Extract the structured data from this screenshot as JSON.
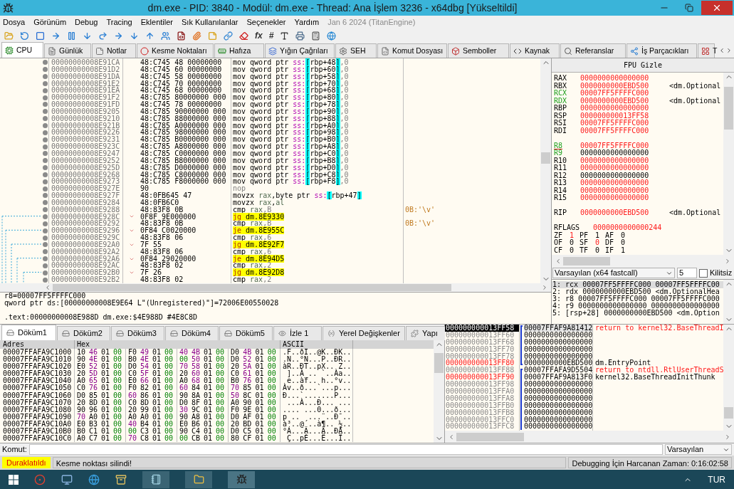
{
  "window": {
    "title": "dm.exe - PID: 3840 - Modül: dm.exe - Thread: Ana İşlem 3236 - x64dbg [Yükseltildi]"
  },
  "menu": {
    "items": [
      "Dosya",
      "Görünüm",
      "Debug",
      "Tracing",
      "Eklentiler",
      "Sık Kullanılanlar",
      "Seçenekler",
      "Yardım"
    ],
    "build_info": "Jan 6 2024 (TitanEngine)"
  },
  "toolbar": {
    "texts": [
      "fx",
      "#"
    ]
  },
  "tabs": [
    {
      "label": "CPU",
      "selected": true
    },
    {
      "label": "Günlük",
      "selected": false
    },
    {
      "label": "Notlar",
      "selected": false
    },
    {
      "label": "Kesme Noktaları",
      "selected": false
    },
    {
      "label": "Hafıza",
      "selected": false
    },
    {
      "label": "Yığın Çağrıları",
      "selected": false
    },
    {
      "label": "SEH",
      "selected": false
    },
    {
      "label": "Komut Dosyası",
      "selected": false
    },
    {
      "label": "Semboller",
      "selected": false
    },
    {
      "label": "Kaynak",
      "selected": false
    },
    {
      "label": "Referanslar",
      "selected": false
    },
    {
      "label": "İş Parçacıkları",
      "selected": false
    },
    {
      "label": "T",
      "selected": false
    }
  ],
  "disassembly": {
    "rows": [
      {
        "address": "00000000008E91CA",
        "bytes": "48:C745 48 00000000",
        "jump": false,
        "instruction": [
          {
            "kind": "mnemonic",
            "text": "mov"
          },
          {
            "kind": "plain",
            "text": " qword ptr "
          },
          {
            "kind": "segment",
            "text": "ss:"
          },
          {
            "kind": "bracket",
            "text": "["
          },
          {
            "kind": "memory",
            "text": "rbp+48"
          },
          {
            "kind": "bracket",
            "text": "]"
          },
          {
            "kind": "number",
            "text": ",0"
          }
        ]
      },
      {
        "address": "00000000008E91D2",
        "bytes": "48:C745 60 00000000",
        "jump": false,
        "instruction": [
          {
            "kind": "mnemonic",
            "text": "mov"
          },
          {
            "kind": "plain",
            "text": " qword ptr "
          },
          {
            "kind": "segment",
            "text": "ss:"
          },
          {
            "kind": "bracket",
            "text": "["
          },
          {
            "kind": "memory",
            "text": "rbp+60"
          },
          {
            "kind": "bracket",
            "text": "]"
          },
          {
            "kind": "number",
            "text": ",0"
          }
        ]
      },
      {
        "address": "00000000008E91DA",
        "bytes": "48:C745 58 00000000",
        "jump": false,
        "instruction": [
          {
            "kind": "mnemonic",
            "text": "mov"
          },
          {
            "kind": "plain",
            "text": " qword ptr "
          },
          {
            "kind": "segment",
            "text": "ss:"
          },
          {
            "kind": "bracket",
            "text": "["
          },
          {
            "kind": "memory",
            "text": "rbp+58"
          },
          {
            "kind": "bracket",
            "text": "]"
          },
          {
            "kind": "number",
            "text": ",0"
          }
        ]
      },
      {
        "address": "00000000008E91E2",
        "bytes": "48:C745 70 00000000",
        "jump": false,
        "instruction": [
          {
            "kind": "mnemonic",
            "text": "mov"
          },
          {
            "kind": "plain",
            "text": " qword ptr "
          },
          {
            "kind": "segment",
            "text": "ss:"
          },
          {
            "kind": "bracket",
            "text": "["
          },
          {
            "kind": "memory",
            "text": "rbp+70"
          },
          {
            "kind": "bracket",
            "text": "]"
          },
          {
            "kind": "number",
            "text": ",0"
          }
        ]
      },
      {
        "address": "00000000008E91EA",
        "bytes": "48:C745 68 00000000",
        "jump": false,
        "instruction": [
          {
            "kind": "mnemonic",
            "text": "mov"
          },
          {
            "kind": "plain",
            "text": " qword ptr "
          },
          {
            "kind": "segment",
            "text": "ss:"
          },
          {
            "kind": "bracket",
            "text": "["
          },
          {
            "kind": "memory",
            "text": "rbp+68"
          },
          {
            "kind": "bracket",
            "text": "]"
          },
          {
            "kind": "number",
            "text": ",0"
          }
        ]
      },
      {
        "address": "00000000008E91F2",
        "bytes": "48:C785 80000000 000",
        "jump": false,
        "instruction": [
          {
            "kind": "mnemonic",
            "text": "mov"
          },
          {
            "kind": "plain",
            "text": " qword ptr "
          },
          {
            "kind": "segment",
            "text": "ss:"
          },
          {
            "kind": "bracket",
            "text": "["
          },
          {
            "kind": "memory",
            "text": "rbp+80"
          },
          {
            "kind": "bracket",
            "text": "]"
          },
          {
            "kind": "number",
            "text": ",0"
          }
        ]
      },
      {
        "address": "00000000008E91FD",
        "bytes": "48:C745 78 00000000",
        "jump": false,
        "instruction": [
          {
            "kind": "mnemonic",
            "text": "mov"
          },
          {
            "kind": "plain",
            "text": " qword ptr "
          },
          {
            "kind": "segment",
            "text": "ss:"
          },
          {
            "kind": "bracket",
            "text": "["
          },
          {
            "kind": "memory",
            "text": "rbp+78"
          },
          {
            "kind": "bracket",
            "text": "]"
          },
          {
            "kind": "number",
            "text": ",0"
          }
        ]
      },
      {
        "address": "00000000008E9205",
        "bytes": "48:C785 90000000 000",
        "jump": false,
        "instruction": [
          {
            "kind": "mnemonic",
            "text": "mov"
          },
          {
            "kind": "plain",
            "text": " qword ptr "
          },
          {
            "kind": "segment",
            "text": "ss:"
          },
          {
            "kind": "bracket",
            "text": "["
          },
          {
            "kind": "memory",
            "text": "rbp+90"
          },
          {
            "kind": "bracket",
            "text": "]"
          },
          {
            "kind": "number",
            "text": ",0"
          }
        ]
      },
      {
        "address": "00000000008E9210",
        "bytes": "48:C785 88000000 000",
        "jump": false,
        "instruction": [
          {
            "kind": "mnemonic",
            "text": "mov"
          },
          {
            "kind": "plain",
            "text": " qword ptr "
          },
          {
            "kind": "segment",
            "text": "ss:"
          },
          {
            "kind": "bracket",
            "text": "["
          },
          {
            "kind": "memory",
            "text": "rbp+88"
          },
          {
            "kind": "bracket",
            "text": "]"
          },
          {
            "kind": "number",
            "text": ",0"
          }
        ]
      },
      {
        "address": "00000000008E921B",
        "bytes": "48:C785 A0000000 000",
        "jump": false,
        "instruction": [
          {
            "kind": "mnemonic",
            "text": "mov"
          },
          {
            "kind": "plain",
            "text": " qword ptr "
          },
          {
            "kind": "segment",
            "text": "ss:"
          },
          {
            "kind": "bracket",
            "text": "["
          },
          {
            "kind": "memory",
            "text": "rbp+A0"
          },
          {
            "kind": "bracket",
            "text": "]"
          },
          {
            "kind": "number",
            "text": ",0"
          }
        ]
      },
      {
        "address": "00000000008E9226",
        "bytes": "48:C785 98000000 000",
        "jump": false,
        "instruction": [
          {
            "kind": "mnemonic",
            "text": "mov"
          },
          {
            "kind": "plain",
            "text": " qword ptr "
          },
          {
            "kind": "segment",
            "text": "ss:"
          },
          {
            "kind": "bracket",
            "text": "["
          },
          {
            "kind": "memory",
            "text": "rbp+98"
          },
          {
            "kind": "bracket",
            "text": "]"
          },
          {
            "kind": "number",
            "text": ",0"
          }
        ]
      },
      {
        "address": "00000000008E9231",
        "bytes": "48:C785 B0000000 000",
        "jump": false,
        "instruction": [
          {
            "kind": "mnemonic",
            "text": "mov"
          },
          {
            "kind": "plain",
            "text": " qword ptr "
          },
          {
            "kind": "segment",
            "text": "ss:"
          },
          {
            "kind": "bracket",
            "text": "["
          },
          {
            "kind": "memory",
            "text": "rbp+B0"
          },
          {
            "kind": "bracket",
            "text": "]"
          },
          {
            "kind": "number",
            "text": ",0"
          }
        ]
      },
      {
        "address": "00000000008E923C",
        "bytes": "48:C785 A8000000 000",
        "jump": false,
        "instruction": [
          {
            "kind": "mnemonic",
            "text": "mov"
          },
          {
            "kind": "plain",
            "text": " qword ptr "
          },
          {
            "kind": "segment",
            "text": "ss:"
          },
          {
            "kind": "bracket",
            "text": "["
          },
          {
            "kind": "memory",
            "text": "rbp+A8"
          },
          {
            "kind": "bracket",
            "text": "]"
          },
          {
            "kind": "number",
            "text": ",0"
          }
        ]
      },
      {
        "address": "00000000008E9247",
        "bytes": "48:C785 C0000000 000",
        "jump": false,
        "instruction": [
          {
            "kind": "mnemonic",
            "text": "mov"
          },
          {
            "kind": "plain",
            "text": " qword ptr "
          },
          {
            "kind": "segment",
            "text": "ss:"
          },
          {
            "kind": "bracket",
            "text": "["
          },
          {
            "kind": "memory",
            "text": "rbp+C0"
          },
          {
            "kind": "bracket",
            "text": "]"
          },
          {
            "kind": "number",
            "text": ",0"
          }
        ]
      },
      {
        "address": "00000000008E9252",
        "bytes": "48:C785 B8000000 000",
        "jump": false,
        "instruction": [
          {
            "kind": "mnemonic",
            "text": "mov"
          },
          {
            "kind": "plain",
            "text": " qword ptr "
          },
          {
            "kind": "segment",
            "text": "ss:"
          },
          {
            "kind": "bracket",
            "text": "["
          },
          {
            "kind": "memory",
            "text": "rbp+B8"
          },
          {
            "kind": "bracket",
            "text": "]"
          },
          {
            "kind": "number",
            "text": ",0"
          }
        ]
      },
      {
        "address": "00000000008E925D",
        "bytes": "48:C785 D0000000 000",
        "jump": false,
        "instruction": [
          {
            "kind": "mnemonic",
            "text": "mov"
          },
          {
            "kind": "plain",
            "text": " qword ptr "
          },
          {
            "kind": "segment",
            "text": "ss:"
          },
          {
            "kind": "bracket",
            "text": "["
          },
          {
            "kind": "memory",
            "text": "rbp+D0"
          },
          {
            "kind": "bracket",
            "text": "]"
          },
          {
            "kind": "number",
            "text": ",0"
          }
        ]
      },
      {
        "address": "00000000008E9268",
        "bytes": "48:C785 C8000000 000",
        "jump": false,
        "instruction": [
          {
            "kind": "mnemonic",
            "text": "mov"
          },
          {
            "kind": "plain",
            "text": " qword ptr "
          },
          {
            "kind": "segment",
            "text": "ss:"
          },
          {
            "kind": "bracket",
            "text": "["
          },
          {
            "kind": "memory",
            "text": "rbp+C8"
          },
          {
            "kind": "bracket",
            "text": "]"
          },
          {
            "kind": "number",
            "text": ",0"
          }
        ]
      },
      {
        "address": "00000000008E9273",
        "bytes": "48:C785 F8000000 000",
        "jump": false,
        "instruction": [
          {
            "kind": "mnemonic",
            "text": "mov"
          },
          {
            "kind": "plain",
            "text": " qword ptr "
          },
          {
            "kind": "segment",
            "text": "ss:"
          },
          {
            "kind": "bracket",
            "text": "["
          },
          {
            "kind": "memory",
            "text": "rbp+F8"
          },
          {
            "kind": "bracket",
            "text": "]"
          },
          {
            "kind": "number",
            "text": ",0"
          }
        ]
      },
      {
        "address": "00000000008E927E",
        "bytes": "90",
        "jump": false,
        "instruction": [
          {
            "kind": "nop",
            "text": "nop"
          }
        ]
      },
      {
        "address": "00000000008E927F",
        "bytes": "48:0FB645 47",
        "jump": false,
        "instruction": [
          {
            "kind": "mnemonic",
            "text": "movzx"
          },
          {
            "kind": "register",
            "text": " rax"
          },
          {
            "kind": "plain",
            "text": ",byte ptr "
          },
          {
            "kind": "segment",
            "text": "ss:"
          },
          {
            "kind": "bracket",
            "text": "["
          },
          {
            "kind": "memory",
            "text": "rbp+47"
          },
          {
            "kind": "bracket",
            "text": "]"
          }
        ]
      },
      {
        "address": "00000000008E9284",
        "bytes": "48:0FB6C0",
        "jump": false,
        "instruction": [
          {
            "kind": "mnemonic",
            "text": "movzx"
          },
          {
            "kind": "register",
            "text": " rax"
          },
          {
            "kind": "plain",
            "text": ","
          },
          {
            "kind": "register",
            "text": "al"
          }
        ]
      },
      {
        "address": "00000000008E9288",
        "bytes": "48:83F8 0B",
        "jump": false,
        "instruction": [
          {
            "kind": "mnemonic",
            "text": "cmp"
          },
          {
            "kind": "register",
            "text": " rax"
          },
          {
            "kind": "number",
            "text": ",B"
          }
        ],
        "comment": "0B:'\\v'"
      },
      {
        "address": "00000000008E928C",
        "bytes": "0F8F 9E000000",
        "jump": true,
        "instruction": [
          {
            "kind": "jump",
            "text": "jg"
          },
          {
            "kind": "target",
            "text": " dm.8E9330"
          }
        ]
      },
      {
        "address": "00000000008E9292",
        "bytes": "48:83F8 0B",
        "jump": false,
        "instruction": [
          {
            "kind": "mnemonic",
            "text": "cmp"
          },
          {
            "kind": "register",
            "text": " rax"
          },
          {
            "kind": "number",
            "text": ",B"
          }
        ],
        "comment": "0B:'\\v'"
      },
      {
        "address": "00000000008E9296",
        "bytes": "0F84 C0020000",
        "jump": true,
        "instruction": [
          {
            "kind": "jump",
            "text": "je"
          },
          {
            "kind": "target",
            "text": " dm.8E955C"
          }
        ]
      },
      {
        "address": "00000000008E929C",
        "bytes": "48:83F8 06",
        "jump": false,
        "instruction": [
          {
            "kind": "mnemonic",
            "text": "cmp"
          },
          {
            "kind": "register",
            "text": " rax"
          },
          {
            "kind": "number",
            "text": ",6"
          }
        ]
      },
      {
        "address": "00000000008E92A0",
        "bytes": "7F 55",
        "jump": true,
        "instruction": [
          {
            "kind": "jump",
            "text": "jg"
          },
          {
            "kind": "target",
            "text": " dm.8E92F7"
          }
        ]
      },
      {
        "address": "00000000008E92A2",
        "bytes": "48:83F8 06",
        "jump": false,
        "instruction": [
          {
            "kind": "mnemonic",
            "text": "cmp"
          },
          {
            "kind": "register",
            "text": " rax"
          },
          {
            "kind": "number",
            "text": ",6"
          }
        ]
      },
      {
        "address": "00000000008E92A6",
        "bytes": "0F84 29020000",
        "jump": true,
        "instruction": [
          {
            "kind": "jump",
            "text": "je"
          },
          {
            "kind": "target",
            "text": " dm.8E94D5"
          }
        ]
      },
      {
        "address": "00000000008E92AC",
        "bytes": "48:83F8 02",
        "jump": false,
        "instruction": [
          {
            "kind": "mnemonic",
            "text": "cmp"
          },
          {
            "kind": "register",
            "text": " rax"
          },
          {
            "kind": "number",
            "text": ",2"
          }
        ]
      },
      {
        "address": "00000000008E92B0",
        "bytes": "7F 26",
        "jump": true,
        "instruction": [
          {
            "kind": "jump",
            "text": "jg"
          },
          {
            "kind": "target",
            "text": " dm.8E92D8"
          }
        ]
      },
      {
        "address": "00000000008E92B2",
        "bytes": "48:83F8 02",
        "jump": false,
        "instruction": [
          {
            "kind": "mnemonic",
            "text": "cmp"
          },
          {
            "kind": "register",
            "text": " rax"
          },
          {
            "kind": "number",
            "text": ",2"
          }
        ]
      }
    ]
  },
  "info": {
    "values": [
      "r8=00007FF5FFFFC000",
      "qword ptr ds:[00000000008E9E64 L\"(Unregistered)\"]=72006E00550028"
    ],
    "location": ".text:00000000008E988D dm.exe:$4E988D #4E8C8D"
  },
  "registers": {
    "header": "FPU Gizle",
    "groups": [
      [
        {
          "name": "RAX",
          "value": "0000000000000000",
          "name_changed": false,
          "value_changed": true,
          "underlined": false
        },
        {
          "name": "RBX",
          "value": "0000000000EBD500",
          "comment": "<dm.Optional",
          "name_changed": false,
          "value_changed": true,
          "underlined": false
        },
        {
          "name": "RCX",
          "value": "00007FF5FFFFC000",
          "name_changed": true,
          "value_changed": true,
          "underlined": false
        },
        {
          "name": "RDX",
          "value": "0000000000EBD500",
          "comment": "<dm.Optional",
          "name_changed": true,
          "value_changed": true,
          "underlined": false
        },
        {
          "name": "RBP",
          "value": "0000000000000000",
          "name_changed": false,
          "value_changed": true,
          "underlined": false
        },
        {
          "name": "RSP",
          "value": "000000000013FF58",
          "name_changed": false,
          "value_changed": true,
          "underlined": false
        },
        {
          "name": "RSI",
          "value": "00007FF5FFFFC000",
          "name_changed": false,
          "value_changed": true,
          "underlined": false
        },
        {
          "name": "RDI",
          "value": "00007FF5FFFFC000",
          "name_changed": false,
          "value_changed": true,
          "underlined": false
        }
      ],
      [
        {
          "name": "R8",
          "value": "00007FF5FFFFC000",
          "name_changed": true,
          "value_changed": true,
          "underlined": true
        },
        {
          "name": "R9",
          "value": "0000000000000000",
          "name_changed": true,
          "value_changed": false,
          "underlined": false
        },
        {
          "name": "R10",
          "value": "0000000000000000",
          "name_changed": false,
          "value_changed": true,
          "underlined": false
        },
        {
          "name": "R11",
          "value": "0000000000000000",
          "name_changed": false,
          "value_changed": true,
          "underlined": false
        },
        {
          "name": "R12",
          "value": "0000000000000000",
          "name_changed": false,
          "value_changed": false,
          "underlined": false
        },
        {
          "name": "R13",
          "value": "0000000000000000",
          "name_changed": false,
          "value_changed": true,
          "underlined": false
        },
        {
          "name": "R14",
          "value": "0000000000000000",
          "name_changed": false,
          "value_changed": true,
          "underlined": false
        },
        {
          "name": "R15",
          "value": "0000000000000000",
          "name_changed": false,
          "value_changed": true,
          "underlined": false
        }
      ],
      [
        {
          "name": "RIP",
          "value": "0000000000EBD500",
          "comment": "<dm.Optional",
          "name_changed": false,
          "value_changed": true,
          "underlined": false
        }
      ]
    ],
    "rflags": {
      "name": "RFLAGS",
      "value": "0000000000000244"
    },
    "flags": [
      {
        "name": "ZF",
        "value": "1",
        "changed": true
      },
      {
        "name": "PF",
        "value": "1",
        "changed": false
      },
      {
        "name": "AF",
        "value": "0",
        "changed": false
      },
      {
        "name": "OF",
        "value": "0",
        "changed": false
      },
      {
        "name": "SF",
        "value": "0",
        "changed": true
      },
      {
        "name": "DF",
        "value": "0",
        "changed": false
      },
      {
        "name": "CF",
        "value": "0",
        "changed": false
      },
      {
        "name": "TF",
        "value": "0",
        "changed": false
      },
      {
        "name": "IF",
        "value": "1",
        "changed": false
      }
    ]
  },
  "call_args": {
    "convention": "Varsayılan (x64 fastcall)",
    "count": "5",
    "unlock": {
      "label": "Kilitsiz",
      "checked": false
    },
    "lines": [
      {
        "text": "1: rcx 00007FF5FFFFC000 00007FF5FFFFC00",
        "selected": true
      },
      {
        "text": "2: rdx 0000000000EBD500 <dm.OptionalHea",
        "selected": false
      },
      {
        "text": "3: r8 00007FF5FFFFC000 00007FF5FFFFC000",
        "selected": false
      },
      {
        "text": "4: r9 0000000000000000 0000000000000000",
        "selected": false
      },
      {
        "text": "5: [rsp+28] 0000000000EBD500 <dm.Option",
        "selected": false
      }
    ]
  },
  "dump": {
    "tabs": [
      {
        "label": "Döküm1",
        "selected": true
      },
      {
        "label": "Döküm2",
        "selected": false
      },
      {
        "label": "Döküm3",
        "selected": false
      },
      {
        "label": "Döküm4",
        "selected": false
      },
      {
        "label": "Döküm5",
        "selected": false
      },
      {
        "label": "İzle 1",
        "selected": false
      },
      {
        "label": "Yerel Değişkenler",
        "selected": false
      },
      {
        "label": "Yapı",
        "selected": false
      }
    ],
    "columns": [
      "Adres",
      "Hex",
      "ASCII"
    ],
    "rows": [
      {
        "address": "00007FFAFA9C1000",
        "hex": "10 46 01 00 F0 49 01 00 40 4B 01 00 D0 4B 01 00",
        "ascii": ".F..ðI..@K..ÐK.."
      },
      {
        "address": "00007FFAFA9C1010",
        "hex": "90 4E 01 00 B0 4E 01 00 00 50 01 00 D0 52 01 00",
        "ascii": ".N..°N...P..ÐR.."
      },
      {
        "address": "00007FFAFA9C1020",
        "hex": "E0 52 01 00 D0 54 01 00 70 58 01 00 20 5A 01 00",
        "ascii": "àR..ÐT..pX.. Z.."
      },
      {
        "address": "00007FFAFA9C1030",
        "hex": "20 5D 01 00 C0 5F 01 00 20 60 01 00 C0 61 01 00",
        "ascii": " ]..À_.. `..Àa.."
      },
      {
        "address": "00007FFAFA9C1040",
        "hex": "A0 65 01 00 E0 66 01 00 A0 68 01 00 B0 76 01 00",
        "ascii": " e..àf.. h..°v.."
      },
      {
        "address": "00007FFAFA9C1050",
        "hex": "C0 76 01 00 F0 82 01 00 60 84 01 00 70 85 01 00",
        "ascii": "Àv..ð...`...p..."
      },
      {
        "address": "00007FFAFA9C1060",
        "hex": "D0 85 01 00 60 86 01 00 90 8A 01 00 50 8C 01 00",
        "ascii": "Ð...`.......P..."
      },
      {
        "address": "00007FFAFA9C1070",
        "hex": "20 8D 01 00 C0 8D 01 00 D0 8F 01 00 A0 90 01 00",
        "ascii": " ...À...Ð... ..."
      },
      {
        "address": "00007FFAFA9C1080",
        "hex": "90 96 01 00 20 99 01 00 30 9C 01 00 F0 9E 01 00",
        "ascii": ".... ...0...ð..."
      },
      {
        "address": "00007FFAFA9C1090",
        "hex": "70 A0 01 00 A0 A0 01 00 90 A8 01 00 D0 AF 01 00",
        "ascii": "p ..  ...¨..Ð¯.."
      },
      {
        "address": "00007FFAFA9C10A0",
        "hex": "E0 B3 01 00 40 B4 01 00 E0 B6 01 00 20 BD 01 00",
        "ascii": "à³..@´..à¶.. ½.."
      },
      {
        "address": "00007FFAFA9C10B0",
        "hex": "B0 C1 01 00 00 C3 01 00 90 C4 01 00 D0 C5 01 00",
        "ascii": "°Á...Ã...Ä..ÐÅ.."
      },
      {
        "address": "00007FFAFA9C10C0",
        "hex": "A0 C7 01 00 70 C8 01 00 00 CB 01 00 80 CF 01 00",
        "ascii": " Ç..pÈ...Ë...Ï.."
      }
    ]
  },
  "stack": {
    "rows": [
      {
        "address": "000000000013FF58",
        "value": "00007FFAF9A81412",
        "comment": "return to kernel32.BaseThreadI",
        "comment_return": true,
        "address_highlight": false,
        "selected": true
      },
      {
        "address": "000000000013FF60",
        "value": "0000000000000000",
        "address_highlight": false,
        "selected": false
      },
      {
        "address": "000000000013FF68",
        "value": "0000000000000000",
        "address_highlight": false,
        "selected": false
      },
      {
        "address": "000000000013FF70",
        "value": "0000000000000000",
        "address_highlight": false,
        "selected": false
      },
      {
        "address": "000000000013FF78",
        "value": "0000000000000000",
        "address_highlight": false,
        "selected": false
      },
      {
        "address": "000000000013FF80",
        "value": "0000000000EBD500",
        "comment": "dm.EntryPoint",
        "comment_return": false,
        "address_highlight": true,
        "selected": false
      },
      {
        "address": "000000000013FF88",
        "value": "00007FFAFA9D5504",
        "comment": "return to ntdll.RtlUserThreadS",
        "comment_return": true,
        "address_highlight": false,
        "selected": false
      },
      {
        "address": "000000000013FF90",
        "value": "00007FFAF9A813F0",
        "comment": "kernel32.BaseThreadInitThunk",
        "comment_return": false,
        "address_highlight": true,
        "selected": false
      },
      {
        "address": "000000000013FF98",
        "value": "0000000000000000",
        "address_highlight": false,
        "selected": false
      },
      {
        "address": "000000000013FFA0",
        "value": "0000000000000000",
        "address_highlight": false,
        "selected": false
      },
      {
        "address": "000000000013FFA8",
        "value": "0000000000000000",
        "address_highlight": false,
        "selected": false
      },
      {
        "address": "000000000013FFB0",
        "value": "0000000000000000",
        "address_highlight": false,
        "selected": false
      },
      {
        "address": "000000000013FFB8",
        "value": "0000000000000000",
        "address_highlight": false,
        "selected": false
      },
      {
        "address": "000000000013FFC0",
        "value": "0000000000000000",
        "address_highlight": false,
        "selected": false
      },
      {
        "address": "000000000013FFC8",
        "value": "0000000000000000",
        "address_highlight": false,
        "selected": false
      }
    ]
  },
  "command": {
    "label": "Komut:",
    "mode": "Varsayılan"
  },
  "status": {
    "state": "Duraklatıldı",
    "message": "Kesme noktası silindi!",
    "elapsed": "Debugging İçin Harcanan Zaman: 0:16:02:58"
  },
  "taskbar": {
    "language": "TUR"
  }
}
